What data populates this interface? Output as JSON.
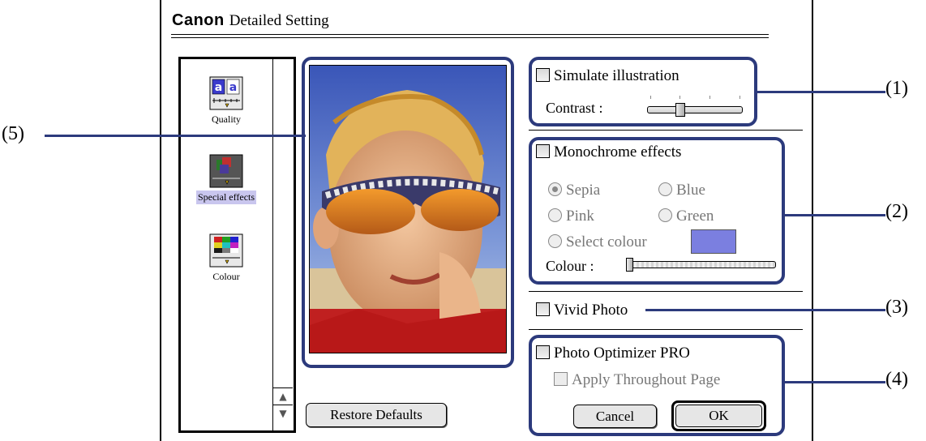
{
  "dialog": {
    "brand": "Canon",
    "title": "Detailed Setting"
  },
  "sidebar": {
    "items": [
      {
        "label": "Quality",
        "icon": "quality-icon"
      },
      {
        "label": "Special effects",
        "icon": "special-effects-icon",
        "selected": true
      },
      {
        "label": "Colour",
        "icon": "colour-icon"
      }
    ],
    "scroll_up": "▲",
    "scroll_down": "▼"
  },
  "preview": {
    "restore_label": "Restore Defaults"
  },
  "simulate": {
    "checkbox_label": "Simulate illustration",
    "contrast_label": "Contrast :"
  },
  "monochrome": {
    "checkbox_label": "Monochrome effects",
    "options": [
      "Sepia",
      "Blue",
      "Pink",
      "Green",
      "Select colour"
    ],
    "selected": "Sepia",
    "colour_label": "Colour :",
    "swatch_color": "#7b7fe0"
  },
  "vivid": {
    "checkbox_label": "Vivid Photo"
  },
  "optimizer": {
    "checkbox_label": "Photo Optimizer PRO",
    "apply_label": "Apply Throughout Page",
    "cancel_label": "Cancel",
    "ok_label": "OK"
  },
  "callouts": [
    "(1)",
    "(2)",
    "(3)",
    "(4)",
    "(5)"
  ],
  "colors": {
    "callout": "#2c3a7c",
    "selection": "#c9c6ee"
  }
}
